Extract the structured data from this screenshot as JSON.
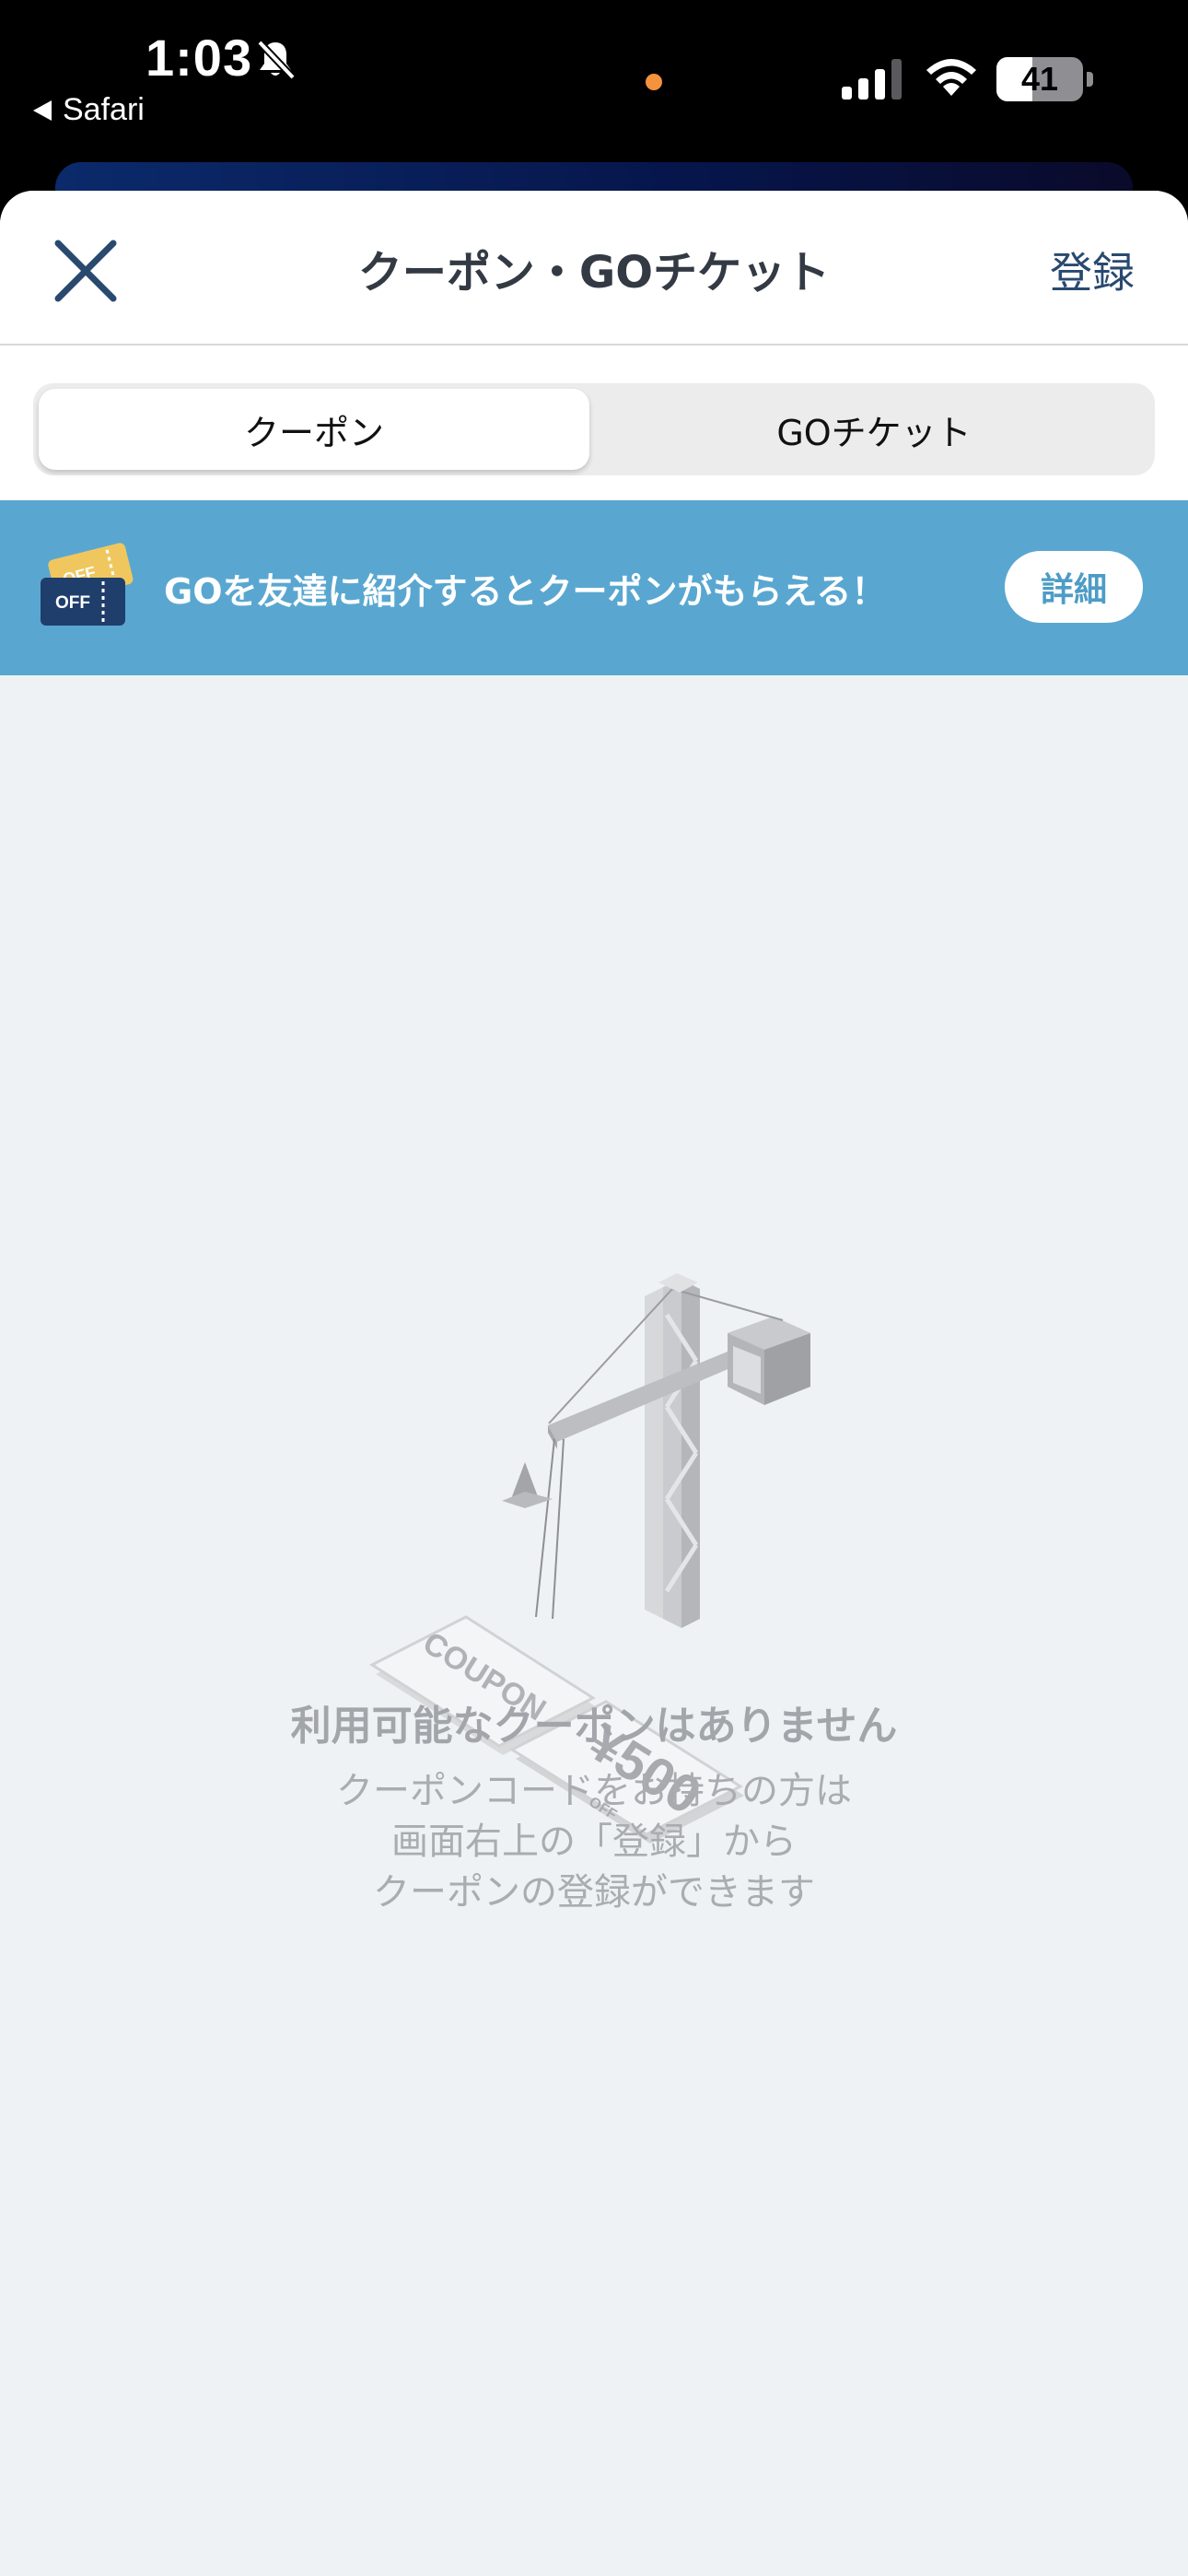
{
  "status_bar": {
    "time": "1:03",
    "back_app": "Safari",
    "battery": "41",
    "battery_level": 0.41
  },
  "header": {
    "title": "クーポン・GOチケット",
    "register_label": "登録"
  },
  "tabs": [
    {
      "label": "クーポン",
      "selected": true
    },
    {
      "label": "GOチケット",
      "selected": false
    }
  ],
  "promo": {
    "text": "GOを友達に紹介するとクーポンがもらえる！",
    "button_label": "詳細",
    "ticket_front_text": "OFF",
    "ticket_back_text": "OFF"
  },
  "illustration": {
    "coupon_text": "COUPON",
    "amount_text": "¥500",
    "off_text": "OFF"
  },
  "empty_state": {
    "title": "利用可能なクーポンはありません",
    "lines": [
      "クーポンコードをお持ちの方は",
      "画面右上の「登録」から",
      "クーポンの登録ができます"
    ]
  },
  "colors": {
    "accent_navy": "#29496f",
    "banner_blue": "#59a7d0",
    "background": "#eff2f5",
    "status_dot": "#f5923e"
  }
}
